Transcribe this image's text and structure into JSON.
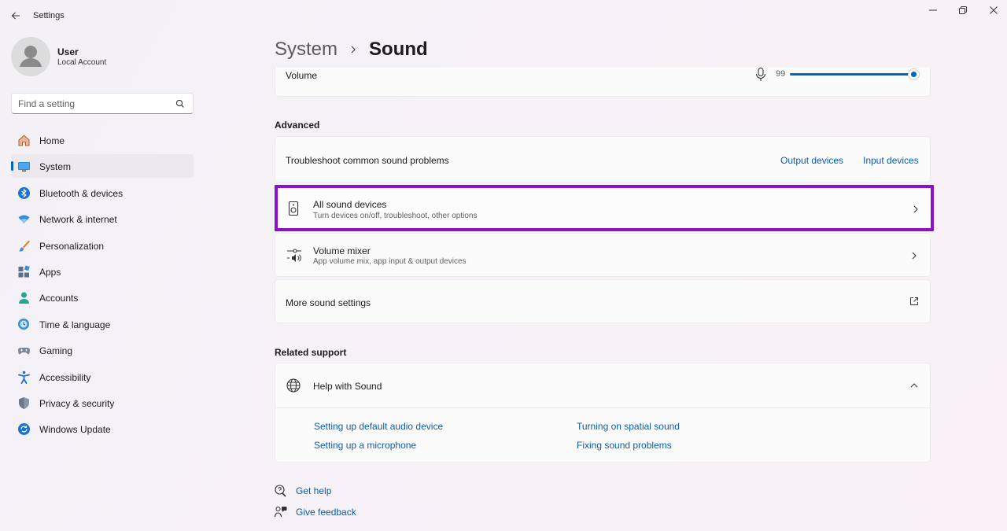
{
  "window": {
    "title": "Settings",
    "controls": [
      "minimize",
      "maximize",
      "close"
    ]
  },
  "user": {
    "name": "User",
    "account_type": "Local Account"
  },
  "search": {
    "placeholder": "Find a setting",
    "value": ""
  },
  "sidebar": {
    "items": [
      {
        "label": "Home",
        "icon": "home-icon",
        "active": false
      },
      {
        "label": "System",
        "icon": "system-icon",
        "active": true
      },
      {
        "label": "Bluetooth & devices",
        "icon": "bluetooth-icon",
        "active": false
      },
      {
        "label": "Network & internet",
        "icon": "wifi-icon",
        "active": false
      },
      {
        "label": "Personalization",
        "icon": "brush-icon",
        "active": false
      },
      {
        "label": "Apps",
        "icon": "apps-icon",
        "active": false
      },
      {
        "label": "Accounts",
        "icon": "accounts-icon",
        "active": false
      },
      {
        "label": "Time & language",
        "icon": "globe-clock-icon",
        "active": false
      },
      {
        "label": "Gaming",
        "icon": "gamepad-icon",
        "active": false
      },
      {
        "label": "Accessibility",
        "icon": "accessibility-icon",
        "active": false
      },
      {
        "label": "Privacy & security",
        "icon": "shield-icon",
        "active": false
      },
      {
        "label": "Windows Update",
        "icon": "update-icon",
        "active": false
      }
    ]
  },
  "breadcrumb": {
    "parent": "System",
    "current": "Sound"
  },
  "volume": {
    "label": "Volume",
    "value": "99",
    "level": 0.99
  },
  "advanced": {
    "heading": "Advanced",
    "troubleshoot": {
      "label": "Troubleshoot common sound problems",
      "output_link": "Output devices",
      "input_link": "Input devices"
    },
    "all_devices": {
      "title": "All sound devices",
      "subtitle": "Turn devices on/off, troubleshoot, other options"
    },
    "volume_mixer": {
      "title": "Volume mixer",
      "subtitle": "App volume mix, app input & output devices"
    },
    "more_settings": {
      "label": "More sound settings"
    }
  },
  "related_support": {
    "heading": "Related support",
    "help_title": "Help with Sound",
    "links": [
      "Setting up default audio device",
      "Turning on spatial sound",
      "Setting up a microphone",
      "Fixing sound problems"
    ]
  },
  "footer": {
    "get_help": "Get help",
    "give_feedback": "Give feedback"
  },
  "colors": {
    "accent": "#0067c0",
    "highlight_border": "#8a13c9",
    "link": "#0b5cad"
  }
}
